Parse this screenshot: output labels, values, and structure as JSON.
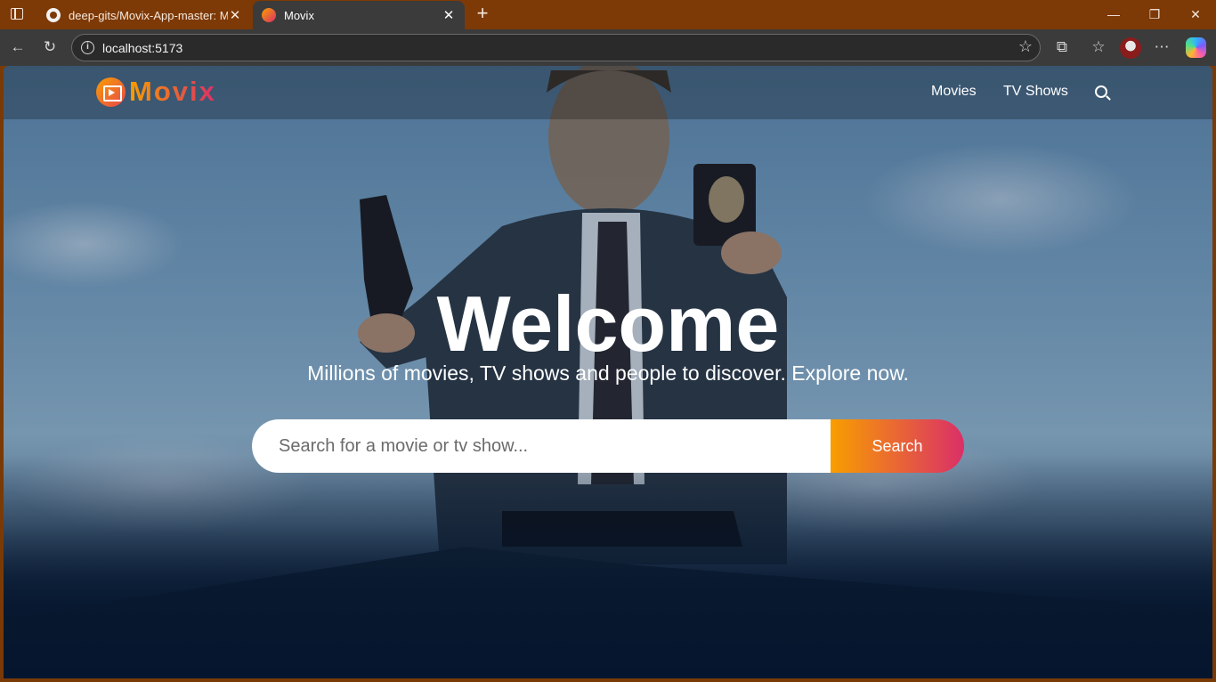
{
  "browser": {
    "tabs": [
      {
        "title": "deep-gits/Movix-App-master: Mi",
        "active": false
      },
      {
        "title": "Movix",
        "active": true
      }
    ],
    "address": "localhost:5173"
  },
  "site": {
    "logo_text": "Movix",
    "nav": {
      "movies": "Movies",
      "tv_shows": "TV Shows"
    }
  },
  "hero": {
    "title": "Welcome",
    "subtitle": "Millions of movies, TV shows and people to discover. Explore now.",
    "search_placeholder": "Search for a movie or tv show...",
    "search_button": "Search"
  },
  "colors": {
    "tabbar": "#7d3906",
    "accent_start": "#f89e00",
    "accent_end": "#da2f68",
    "page_bg": "#04152d"
  }
}
